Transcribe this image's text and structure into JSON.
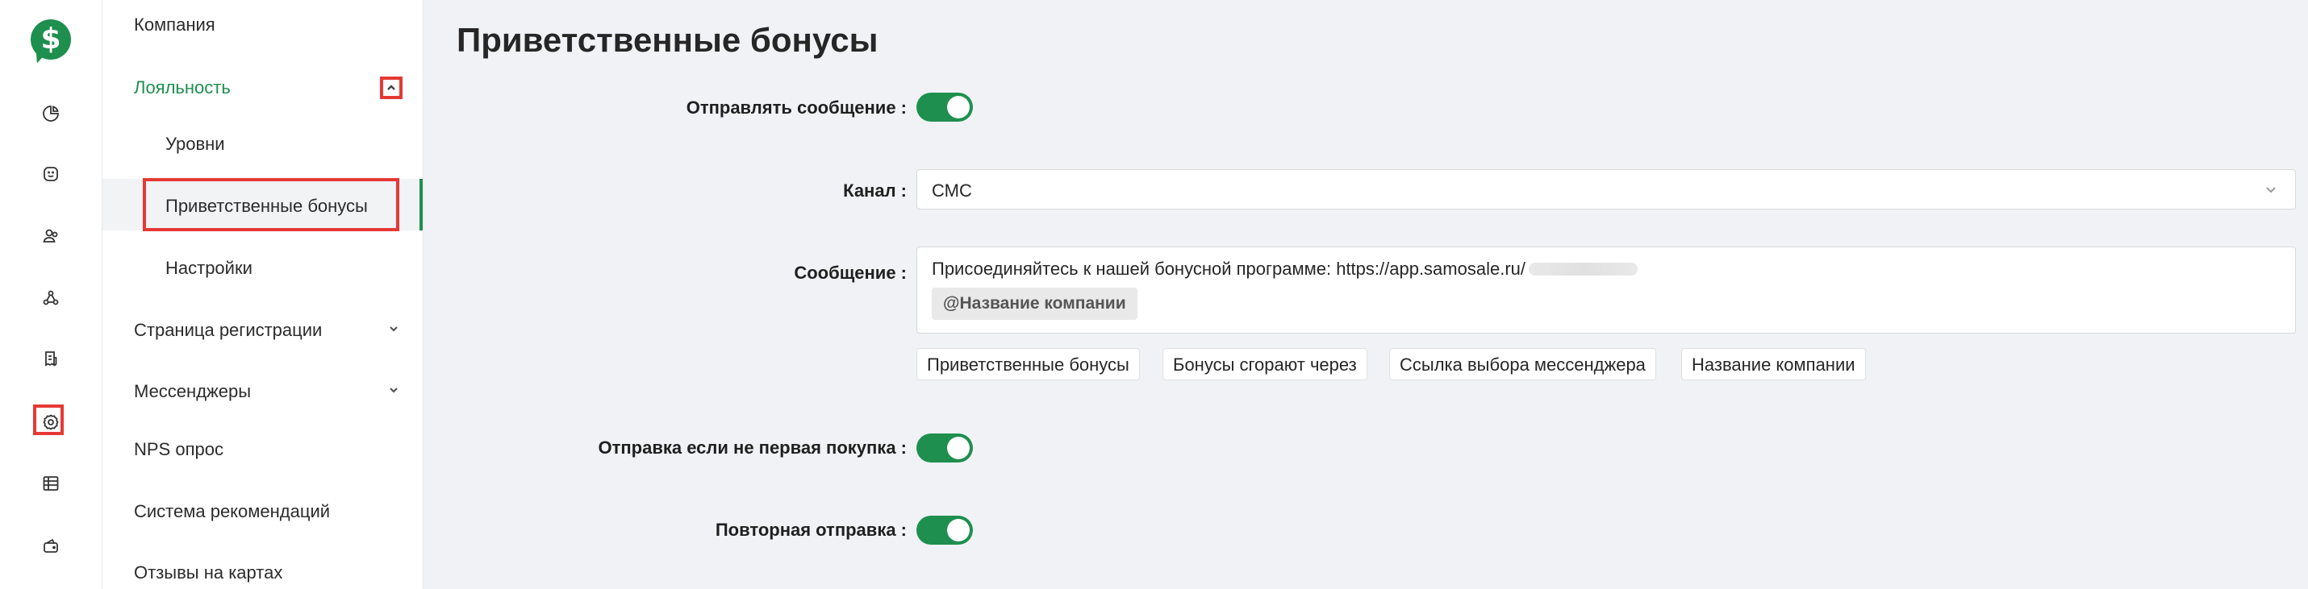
{
  "app": {
    "logo_symbol": "$"
  },
  "rail": {
    "icons": [
      "logo-icon",
      "pie-chart-icon",
      "smile-icon",
      "users-icon",
      "share-network-icon",
      "receipt-icon",
      "settings-gear-icon",
      "table-icon",
      "wallet-icon"
    ],
    "active": "settings-gear-icon",
    "accent": "#1e8f4e",
    "highlight": "#e53935"
  },
  "sidebar": {
    "company": "Компания",
    "loyalty": "Лояльность",
    "levels": "Уровни",
    "welcome_bonuses": "Приветственные бонусы",
    "settings": "Настройки",
    "registration_page": "Страница регистрации",
    "messengers": "Мессенджеры",
    "nps": "NPS опрос",
    "referral": "Система рекомендаций",
    "map_reviews": "Отзывы на картах"
  },
  "main": {
    "title": "Приветственные бонусы",
    "send_message_label": "Отправлять сообщение :",
    "send_message_on": true,
    "channel_label": "Канал :",
    "channel_value": "СМС",
    "message_label": "Сообщение :",
    "message_text": "Присоединяйтесь к нашей бонусной программе: https://app.samosale.ru/",
    "message_mention": "@Название компании",
    "variables": [
      "Приветственные бонусы",
      "Бонусы сгорают через",
      "Ссылка выбора мессенджера",
      "Название компании"
    ],
    "not_first_purchase_label": "Отправка если не первая покупка :",
    "not_first_purchase_on": true,
    "resend_label": "Повторная отправка :",
    "resend_on": true
  }
}
